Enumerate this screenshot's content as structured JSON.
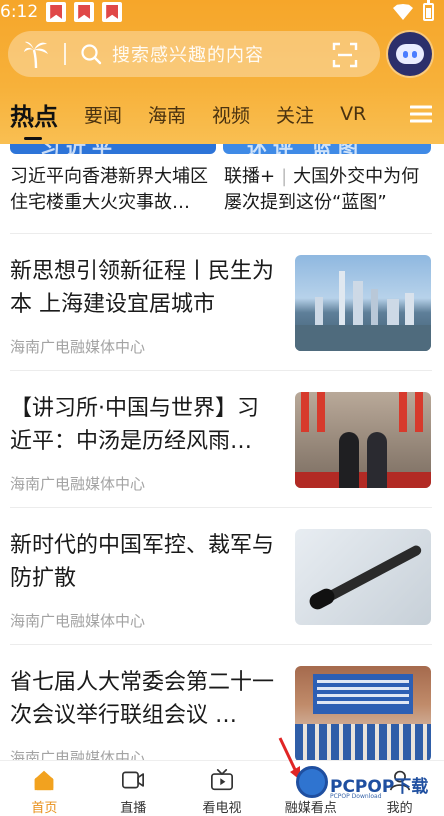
{
  "status_bar": {
    "time": "6:12"
  },
  "search": {
    "placeholder": "搜索感兴趣的内容"
  },
  "tabs": [
    {
      "label": "热点",
      "active": true
    },
    {
      "label": "要闻",
      "active": false
    },
    {
      "label": "海南",
      "active": false
    },
    {
      "label": "视频",
      "active": false
    },
    {
      "label": "关注",
      "active": false
    },
    {
      "label": "VR",
      "active": false
    }
  ],
  "top_cards": [
    {
      "title": "习近平向香港新界大埔区住宅楼重大火灾事故…",
      "thumb_text": "习近平"
    },
    {
      "prefix": "联播+",
      "separator": "|",
      "title": "大国外交中为何屡次提到这份“蓝图”",
      "thumb_text": "述评 蓝图"
    }
  ],
  "news": [
    {
      "title": "新思想引领新征程丨民生为本 上海建设宜居城市",
      "source": "海南广电融媒体中心",
      "thumb": "city"
    },
    {
      "title": "【讲习所·中国与世界】习近平：中汤是历经风雨…",
      "source": "海南广电融媒体中心",
      "thumb": "meeting"
    },
    {
      "title": "新时代的中国军控、裁军与防扩散",
      "source": "海南广电融媒体中心",
      "thumb": "mic"
    },
    {
      "title": "省七届人大常委会第二十一次会议举行联组会议 …",
      "source": "海南广电融媒体中心",
      "thumb": "assembly"
    }
  ],
  "bottom_nav": [
    {
      "label": "首页",
      "icon": "home-icon",
      "active": true
    },
    {
      "label": "直播",
      "icon": "live-camera-icon",
      "active": false
    },
    {
      "label": "看电视",
      "icon": "tv-icon",
      "active": false
    },
    {
      "label": "融媒看点",
      "icon": "media-icon",
      "active": false
    },
    {
      "label": "我的",
      "icon": "user-icon",
      "active": false
    }
  ],
  "watermark": {
    "text": "PCPOP下载",
    "sub": "PCPOP Download"
  },
  "colors": {
    "header_orange": "#f6a62a",
    "active_nav": "#e8901a",
    "source_gray": "#a3a3a3"
  }
}
